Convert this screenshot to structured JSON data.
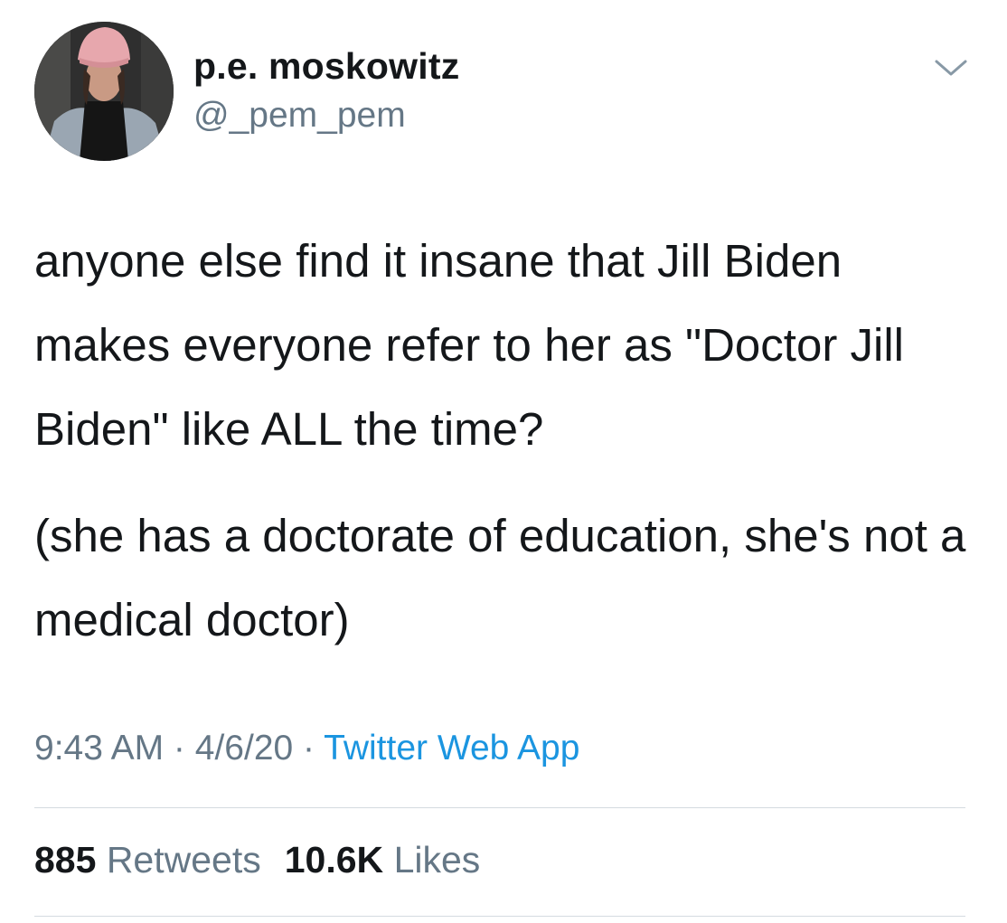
{
  "author": {
    "display_name": "p.e. moskowitz",
    "handle": "@_pem_pem",
    "avatar_icon": "profile-photo"
  },
  "menu": {
    "icon": "chevron-down-icon"
  },
  "tweet": {
    "paragraphs": [
      "anyone else find it insane that Jill Biden makes everyone refer to her as \"Doctor Jill Biden\" like ALL the time?",
      "(she has a doctorate of education, she's not a medical doctor)"
    ],
    "time": "9:43 AM",
    "separator": " · ",
    "date": "4/6/20",
    "source": "Twitter Web App"
  },
  "stats": {
    "retweets_count": "885",
    "retweets_label": "Retweets",
    "likes_count": "10.6K",
    "likes_label": "Likes"
  },
  "colors": {
    "text": "#14171a",
    "secondary": "#657786",
    "link": "#1b95e0",
    "divider": "#d4dbe0"
  }
}
